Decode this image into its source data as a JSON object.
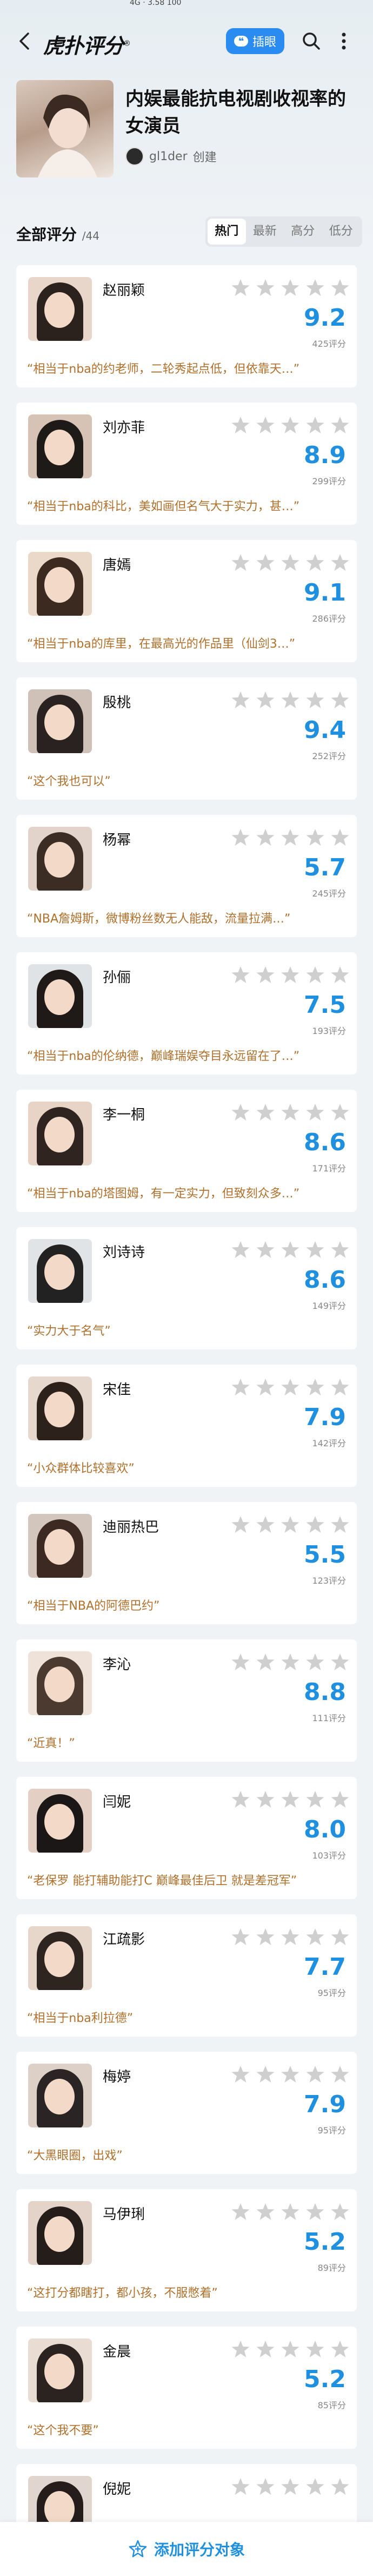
{
  "status_bar": {
    "text": "4G ⋅ 3.58 100"
  },
  "navbar": {
    "logo_text": "虎扑评分",
    "logo_mark": "®",
    "insert_button_label": "插眼",
    "insert_icon": "quote-icon",
    "icons": [
      "back-icon",
      "search-icon",
      "more-icon"
    ]
  },
  "header": {
    "title": "内娱最能抗电视剧收视率的女演员",
    "creator_name": "gl1der",
    "creator_suffix": "创建"
  },
  "section": {
    "title": "全部评分",
    "count": "/44",
    "sort_tabs": [
      "热门",
      "最新",
      "高分",
      "低分"
    ],
    "active_sort": "热门"
  },
  "colors": {
    "accent": "#1f8fe0",
    "quote": "#b0702c",
    "star": "#c8c8c8"
  },
  "items": [
    {
      "name": "赵丽颖",
      "score": "9.2",
      "count": "425评分",
      "quote": "“相当于nba的约老师，二轮秀起点低，但依靠天…”"
    },
    {
      "name": "刘亦菲",
      "score": "8.9",
      "count": "299评分",
      "quote": "“相当于nba的科比，美如画但名气大于实力，甚…”"
    },
    {
      "name": "唐嫣",
      "score": "9.1",
      "count": "286评分",
      "quote": "“相当于nba的库里，在最高光的作品里（仙剑3…”"
    },
    {
      "name": "殷桃",
      "score": "9.4",
      "count": "252评分",
      "quote": "“这个我也可以”"
    },
    {
      "name": "杨幂",
      "score": "5.7",
      "count": "245评分",
      "quote": "“NBA詹姆斯，微博粉丝数无人能敌，流量拉满…”"
    },
    {
      "name": "孙俪",
      "score": "7.5",
      "count": "193评分",
      "quote": "“相当于nba的伦纳德，巅峰瑞娱夺目永远留在了…”"
    },
    {
      "name": "李一桐",
      "score": "8.6",
      "count": "171评分",
      "quote": "“相当于nba的塔图姆，有一定实力，但致刻众多…”"
    },
    {
      "name": "刘诗诗",
      "score": "8.6",
      "count": "149评分",
      "quote": "“实力大于名气”"
    },
    {
      "name": "宋佳",
      "score": "7.9",
      "count": "142评分",
      "quote": "“小众群体比较喜欢”"
    },
    {
      "name": "迪丽热巴",
      "score": "5.5",
      "count": "123评分",
      "quote": "“相当于NBA的阿德巴约”"
    },
    {
      "name": "李沁",
      "score": "8.8",
      "count": "111评分",
      "quote": "“近真！”"
    },
    {
      "name": "闫妮",
      "score": "8.0",
      "count": "103评分",
      "quote": "“老保罗 能打辅助能打C 巅峰最佳后卫 就是差冠军”"
    },
    {
      "name": "江疏影",
      "score": "7.7",
      "count": "95评分",
      "quote": "“相当于nba利拉德”"
    },
    {
      "name": "梅婷",
      "score": "7.9",
      "count": "95评分",
      "quote": "“大黑眼圈，出戏”"
    },
    {
      "name": "马伊琍",
      "score": "5.2",
      "count": "89评分",
      "quote": "“这打分都瞎打，都小孩，不服憋着”"
    },
    {
      "name": "金晨",
      "score": "5.2",
      "count": "85评分",
      "quote": "“这个我不要”"
    },
    {
      "name": "倪妮",
      "score": "",
      "count": "",
      "quote": ""
    }
  ],
  "bottom": {
    "add_label": "添加评分对象",
    "add_icon": "star-plus-icon"
  }
}
